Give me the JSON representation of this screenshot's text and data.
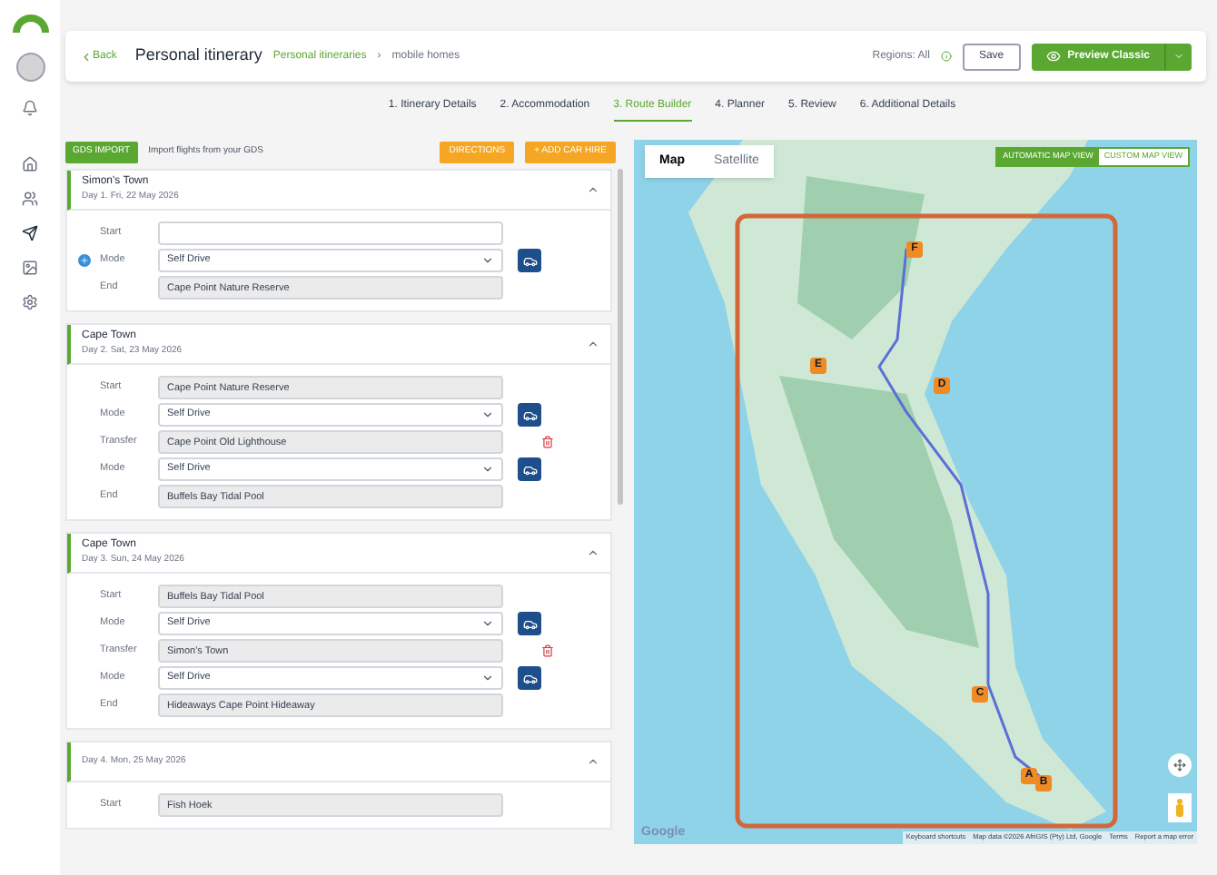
{
  "header": {
    "back": "Back",
    "title": "Personal itinerary",
    "breadcrumb": [
      "Personal itineraries",
      "mobile homes"
    ],
    "breadcrumb_separator": "›",
    "regions": "Regions: All",
    "save": "Save",
    "preview": "Preview Classic"
  },
  "steps": [
    {
      "label": "1. Itinerary Details",
      "selected": false
    },
    {
      "label": "2. Accommodation",
      "selected": false
    },
    {
      "label": "3. Route Builder",
      "selected": true
    },
    {
      "label": "4. Planner",
      "selected": false
    },
    {
      "label": "5. Review",
      "selected": false
    },
    {
      "label": "6. Additional Details",
      "selected": false
    }
  ],
  "toolbar": {
    "gds_button": "GDS IMPORT",
    "gds_text": "Import flights from your GDS",
    "directions": "DIRECTIONS",
    "add_car_hire": "+ ADD CAR HIRE"
  },
  "days": [
    {
      "title": "Simon's Town",
      "date": "Day 1. Fri, 22 May 2026",
      "add_stop": true,
      "rows": [
        {
          "kind": "field",
          "label": "Start",
          "value": "",
          "disabled": false,
          "removable": false
        },
        {
          "kind": "select",
          "label": "Mode",
          "value": "Self Drive"
        },
        {
          "kind": "field",
          "label": "End",
          "value": "Cape Point Nature Reserve",
          "disabled": true,
          "removable": false
        }
      ]
    },
    {
      "title": "Cape Town",
      "date": "Day 2. Sat, 23 May 2026",
      "add_stop": false,
      "rows": [
        {
          "kind": "field",
          "label": "Start",
          "value": "Cape Point Nature Reserve",
          "disabled": true,
          "removable": false
        },
        {
          "kind": "select",
          "label": "Mode",
          "value": "Self Drive"
        },
        {
          "kind": "field",
          "label": "Transfer",
          "value": "Cape Point Old Lighthouse",
          "disabled": true,
          "removable": true
        },
        {
          "kind": "select",
          "label": "Mode",
          "value": "Self Drive"
        },
        {
          "kind": "field",
          "label": "End",
          "value": "Buffels Bay Tidal Pool",
          "disabled": true,
          "removable": false
        }
      ]
    },
    {
      "title": "Cape Town",
      "date": "Day 3. Sun, 24 May 2026",
      "add_stop": false,
      "rows": [
        {
          "kind": "field",
          "label": "Start",
          "value": "Buffels Bay Tidal Pool",
          "disabled": true,
          "removable": false
        },
        {
          "kind": "select",
          "label": "Mode",
          "value": "Self Drive"
        },
        {
          "kind": "field",
          "label": "Transfer",
          "value": "Simon's Town",
          "disabled": true,
          "removable": true
        },
        {
          "kind": "select",
          "label": "Mode",
          "value": "Self Drive"
        },
        {
          "kind": "field",
          "label": "End",
          "value": "Hideaways Cape Point Hideaway",
          "disabled": true,
          "removable": false
        }
      ]
    },
    {
      "date": "Day 4. Mon, 25 May 2026",
      "add_stop": false,
      "rows": [
        {
          "kind": "field",
          "label": "Start",
          "value": "Fish Hoek",
          "disabled": true,
          "removable": false
        }
      ]
    }
  ],
  "map": {
    "map_tab": {
      "label": "Map",
      "selected": true
    },
    "satellite_tab": {
      "label": "Satellite",
      "selected": false
    },
    "views": [
      {
        "label": "AUTOMATIC MAP VIEW",
        "selected": true
      },
      {
        "label": "CUSTOM MAP VIEW",
        "selected": false
      }
    ],
    "markers": [
      "F",
      "E",
      "D",
      "C",
      "A",
      "B"
    ],
    "logo": "Google",
    "footer": [
      "Keyboard shortcuts",
      "Map data ©2026 AfriGIS (Pty) Ltd, Google",
      "Terms",
      "Report a map error"
    ]
  }
}
